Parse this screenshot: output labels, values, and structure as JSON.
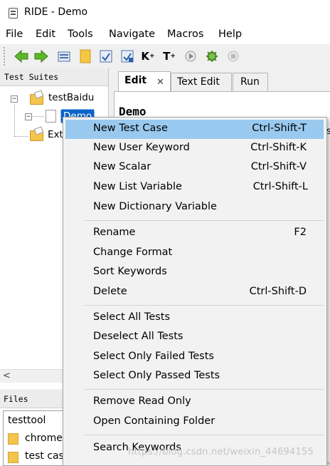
{
  "window": {
    "title": "RIDE - Demo"
  },
  "menubar": {
    "items": [
      "File",
      "Edit",
      "Tools",
      "Navigate",
      "Macros",
      "Help"
    ]
  },
  "toolbar": {
    "buttons": [
      "back-icon",
      "forward-icon",
      "open-directory-icon",
      "open-folder-icon",
      "save-icon",
      "save-all-icon",
      "keyword-search-icon",
      "test-tag-icon",
      "run-icon",
      "debug-icon",
      "stop-icon"
    ]
  },
  "test_suites": {
    "header": "Test Suites",
    "tree": [
      "testBaidu",
      "Demo",
      "Ext"
    ]
  },
  "files": {
    "header": "Files",
    "items": [
      "testtool",
      "chrome",
      "test cas"
    ]
  },
  "editor": {
    "tabs": [
      "Edit",
      "Text Edit",
      "Run"
    ],
    "heading": "Demo",
    "partial_text": "s"
  },
  "context_menu": {
    "groups": [
      [
        {
          "label": "New Test Case",
          "shortcut": "Ctrl-Shift-T"
        },
        {
          "label": "New User Keyword",
          "shortcut": "Ctrl-Shift-K"
        },
        {
          "label": "New Scalar",
          "shortcut": "Ctrl-Shift-V"
        },
        {
          "label": "New List Variable",
          "shortcut": "Ctrl-Shift-L"
        },
        {
          "label": "New Dictionary Variable",
          "shortcut": ""
        }
      ],
      [
        {
          "label": "Rename",
          "shortcut": "F2"
        },
        {
          "label": "Change Format",
          "shortcut": ""
        },
        {
          "label": "Sort Keywords",
          "shortcut": ""
        },
        {
          "label": "Delete",
          "shortcut": "Ctrl-Shift-D"
        }
      ],
      [
        {
          "label": "Select All Tests",
          "shortcut": ""
        },
        {
          "label": "Deselect All Tests",
          "shortcut": ""
        },
        {
          "label": "Select Only Failed Tests",
          "shortcut": ""
        },
        {
          "label": "Select Only Passed Tests",
          "shortcut": ""
        }
      ],
      [
        {
          "label": "Remove Read Only",
          "shortcut": ""
        },
        {
          "label": "Open Containing Folder",
          "shortcut": ""
        }
      ],
      [
        {
          "label": "Search Keywords",
          "shortcut": ""
        }
      ]
    ]
  },
  "watermark": "https://blog.csdn.net/weixin_44694155",
  "colors": {
    "highlight": "#99c9ef",
    "selection": "#0a64c8"
  }
}
